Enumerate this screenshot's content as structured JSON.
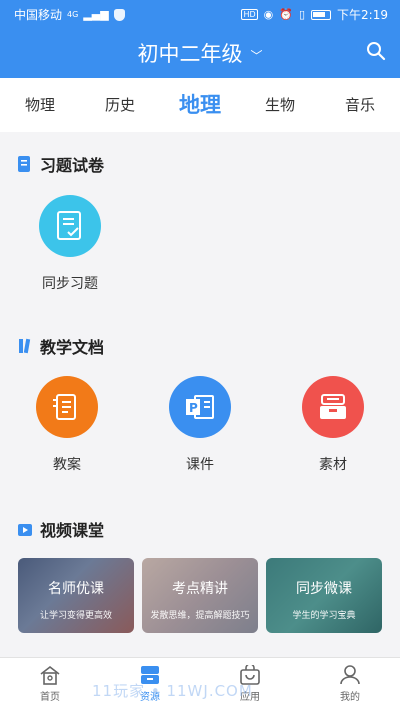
{
  "status_bar": {
    "carrier": "中国移动",
    "network": "4G",
    "time": "下午2:19",
    "hd": "HD"
  },
  "header": {
    "title": "初中二年级"
  },
  "tabs": [
    {
      "label": "物理"
    },
    {
      "label": "历史"
    },
    {
      "label": "地理",
      "active": true
    },
    {
      "label": "生物"
    },
    {
      "label": "音乐"
    }
  ],
  "sections": {
    "exercises": {
      "title": "习题试卷",
      "items": [
        {
          "label": "同步习题",
          "icon": "checklist-icon",
          "color": "#3cc4ea"
        }
      ]
    },
    "documents": {
      "title": "教学文档",
      "items": [
        {
          "label": "教案",
          "icon": "lesson-plan-icon",
          "color": "#f27a18"
        },
        {
          "label": "课件",
          "icon": "ppt-icon",
          "color": "#3a8ff0"
        },
        {
          "label": "素材",
          "icon": "archive-icon",
          "color": "#f0524d"
        }
      ]
    },
    "videos": {
      "title": "视频课堂",
      "cards": [
        {
          "title": "名师优课",
          "subtitle": "让学习变得更高效"
        },
        {
          "title": "考点精讲",
          "subtitle": "发散思维，提高解题技巧"
        },
        {
          "title": "同步微课",
          "subtitle": "学生的学习宝典"
        }
      ]
    }
  },
  "bottom_nav": [
    {
      "label": "首页",
      "icon": "home-icon"
    },
    {
      "label": "资源",
      "icon": "resource-icon",
      "active": true
    },
    {
      "label": "应用",
      "icon": "bag-icon"
    },
    {
      "label": "我的",
      "icon": "user-icon"
    }
  ],
  "watermark": "11玩家 • 11WJ.COM",
  "colors": {
    "primary": "#3a8ff0",
    "background": "#f4f4f6"
  }
}
